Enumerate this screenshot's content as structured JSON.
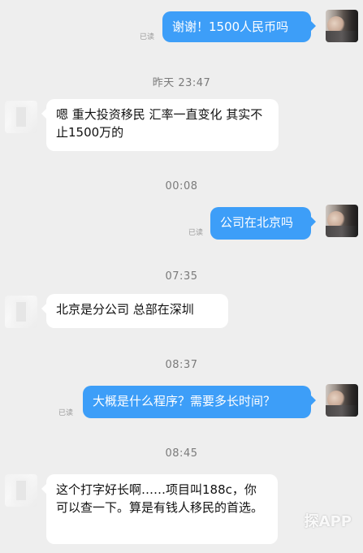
{
  "messages": [
    {
      "type": "out",
      "text": "谢谢！1500人民币吗",
      "read": "已读"
    },
    {
      "type": "timestamp",
      "text": "昨天 23:47"
    },
    {
      "type": "in",
      "text": "嗯 重大投资移民 汇率一直变化 其实不止1500万的"
    },
    {
      "type": "timestamp",
      "text": "00:08"
    },
    {
      "type": "out",
      "text": "公司在北京吗",
      "read": "已读"
    },
    {
      "type": "timestamp",
      "text": "07:35"
    },
    {
      "type": "in",
      "text": "北京是分公司 总部在深圳"
    },
    {
      "type": "timestamp",
      "text": "08:37"
    },
    {
      "type": "out",
      "text": "大概是什么程序？需要多长时间？",
      "read": "已读"
    },
    {
      "type": "timestamp",
      "text": "08:45"
    },
    {
      "type": "in",
      "text": "这个打字好长啊……项目叫188c，你可以查一下。算是有钱人移民的首选。"
    }
  ],
  "watermark": "探APP",
  "colors": {
    "background": "#eeeeee",
    "outgoing_bubble": "#3d9ef8",
    "incoming_bubble": "#ffffff",
    "timestamp_text": "#7a7a7a"
  }
}
